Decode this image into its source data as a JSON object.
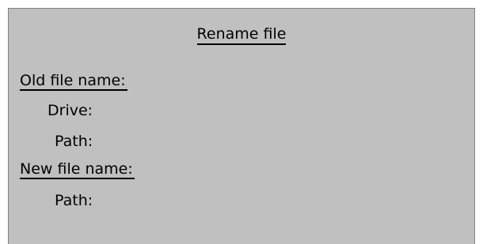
{
  "dialog": {
    "title": "Rename file",
    "old_section": {
      "label": "Old file name:",
      "drive_label": "Drive:",
      "path_label": "Path:"
    },
    "new_section": {
      "label": "New file name:",
      "path_label": "Path:"
    }
  }
}
